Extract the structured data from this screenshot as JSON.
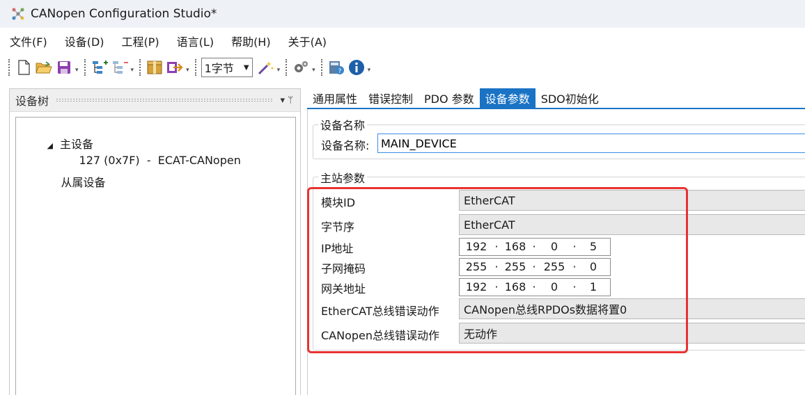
{
  "window": {
    "title": "CANopen Configuration Studio*"
  },
  "menu": [
    "文件(F)",
    "设备(D)",
    "工程(P)",
    "语言(L)",
    "帮助(H)",
    "关于(A)"
  ],
  "toolbar": {
    "byte_select": "1字节",
    "icons": [
      "new-file-icon",
      "open-folder-icon",
      "save-icon",
      "add-node-icon",
      "remove-node-icon",
      "package-icon",
      "export-icon",
      "magic-wand-icon",
      "settings-icon",
      "calculator-help-icon",
      "info-icon"
    ]
  },
  "device_tree": {
    "title": "设备树",
    "pin": "▾ ᛘ",
    "master_label": "主设备",
    "master_device": "127 (0x7F)  -  ECAT-CANopen",
    "slave_label": "从属设备"
  },
  "tabs": [
    "通用属性",
    "错误控制",
    "PDO 参数",
    "设备参数",
    "SDO初始化"
  ],
  "active_tab": "设备参数",
  "device_name_group": {
    "legend": "设备名称",
    "label": "设备名称:",
    "value": "MAIN_DEVICE"
  },
  "master_params": {
    "legend": "主站参数",
    "module_id_label": "模块ID",
    "module_id_value": "EtherCAT",
    "byte_order_label": "字节序",
    "byte_order_value": "EtherCAT",
    "ip_label": "IP地址",
    "ip": [
      "192",
      "168",
      "0",
      "5"
    ],
    "mask_label": "子网掩码",
    "mask": [
      "255",
      "255",
      "255",
      "0"
    ],
    "gateway_label": "网关地址",
    "gateway": [
      "192",
      "168",
      "0",
      "1"
    ],
    "ethercat_err_label": "EtherCAT总线错误动作",
    "ethercat_err_value": "CANopen总线RPDOs数据将置0",
    "canopen_err_label": "CANopen总线错误动作",
    "canopen_err_value": "无动作"
  },
  "colors": {
    "accent": "#1a73c4",
    "highlight": "#e83232",
    "title_bg": "#eef1f6"
  }
}
